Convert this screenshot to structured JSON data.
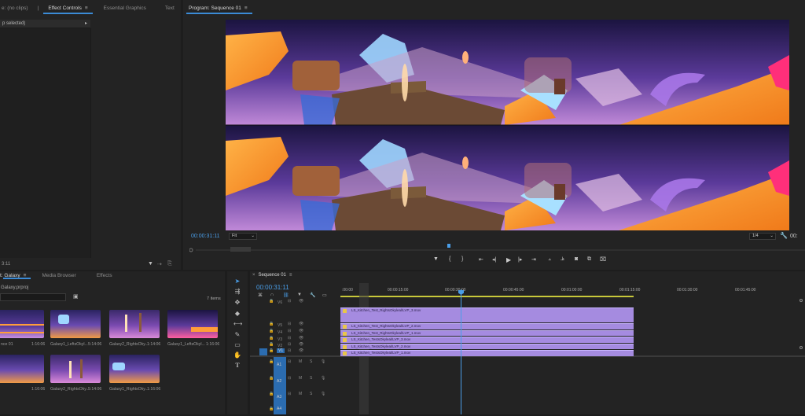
{
  "top_left_panel": {
    "tabs": [
      {
        "label": "e: (no clips)",
        "active": false
      },
      {
        "label": "Effect Controls",
        "active": true
      },
      {
        "label": "Essential Graphics",
        "active": false
      },
      {
        "label": "Text",
        "active": false
      }
    ],
    "header": "p selected)",
    "timecode": "3:11"
  },
  "program_monitor": {
    "title": "Program: Sequence 01",
    "timecode": "00:00:31:11",
    "zoom": "Fit",
    "resolution": "1/4",
    "duration": "00:"
  },
  "project_panel": {
    "tabs": [
      {
        "label": "t: Galaxy",
        "active": true
      },
      {
        "label": "Media Browser",
        "active": false
      },
      {
        "label": "Effects",
        "active": false
      }
    ],
    "project_file": "Galaxy.prproj",
    "item_count": "7 items",
    "items": [
      {
        "name": "nce 01",
        "duration": "1:16:06"
      },
      {
        "name": "Galaxy1_LeftsOkyl...",
        "duration": "5:14:06"
      },
      {
        "name": "Galaxy2_RightsOky...",
        "duration": "1:14:06"
      },
      {
        "name": "Galaxy1_LeftsOkyl...",
        "duration": "1:16:06"
      },
      {
        "name": "",
        "duration": "1:16:06"
      },
      {
        "name": "Galaxy2_RightsOky...",
        "duration": "5:14:06"
      },
      {
        "name": "Galaxy1_RightsOky...",
        "duration": "1:16:06"
      },
      {
        "name": "Galaxy2_RightsOky...",
        "duration": "1:16:06"
      }
    ]
  },
  "timeline": {
    "title": "Sequence 01",
    "timecode": "00:00:31:11",
    "ruler_labels": [
      ":00:00",
      "00:00:15:00",
      "00:00:30:00",
      "00:00:45:00",
      "00:01:00:00",
      "00:01:15:00",
      "00:01:30:00",
      "00:01:45:00"
    ],
    "video_tracks": [
      "V6",
      "V5",
      "V4",
      "V3",
      "V2",
      "V1"
    ],
    "audio_tracks": [
      "A1",
      "A2",
      "A3",
      "A4"
    ],
    "clips": [
      "LS_Kitchen_Test_RightsOkyleal/LVP_3.mov",
      "LS_Kitchen_Test_RightsOkyleal/LVP_2.mov",
      "LS_Kitchen_Test_RightsOkyleal/LVP_1.mov",
      "LS_Kitchen_TestsOkyleal/LVP_3.mov",
      "LS_Kitchen_TestsOkyleal/LVP_2.mov",
      "LS_Kitchen_TestsOkyleal/LVP_1.mov"
    ]
  },
  "colors": {
    "accent": "#3b8bd6",
    "clip": "#a58be0",
    "playhead": "#4a9ee8",
    "work_area": "#c8c83a"
  }
}
